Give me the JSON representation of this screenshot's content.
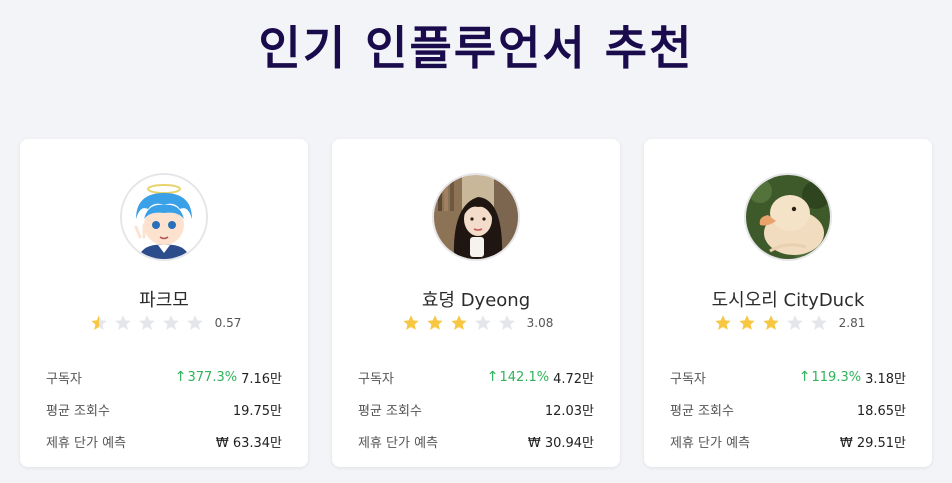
{
  "page": {
    "title": "인기 인플루언서 추천"
  },
  "colors": {
    "star_filled": "#f7c744",
    "star_empty": "#e4e6eb",
    "growth": "#2fb35a",
    "title": "#1a0b4d"
  },
  "cards": [
    {
      "name": "파크모",
      "rating": 0.57,
      "rating_text": "0.57",
      "avatar_icon": "anime-boy-avatar",
      "stats": {
        "subscribers_label": "구독자",
        "subscribers_growth": "377.3%",
        "subscribers_value": "7.16만",
        "views_label": "평균 조회수",
        "views_value": "19.75만",
        "price_label": "제휴 단가 예측",
        "price_value": "₩ 63.34만"
      }
    },
    {
      "name": "효뎡 Dyeong",
      "rating": 3.08,
      "rating_text": "3.08",
      "avatar_icon": "woman-portrait-avatar",
      "stats": {
        "subscribers_label": "구독자",
        "subscribers_growth": "142.1%",
        "subscribers_value": "4.72만",
        "views_label": "평균 조회수",
        "views_value": "12.03만",
        "price_label": "제휴 단가 예측",
        "price_value": "₩ 30.94만"
      }
    },
    {
      "name": "도시오리 CityDuck",
      "rating": 2.81,
      "rating_text": "2.81",
      "avatar_icon": "duckling-avatar",
      "stats": {
        "subscribers_label": "구독자",
        "subscribers_growth": "119.3%",
        "subscribers_value": "3.18만",
        "views_label": "평균 조회수",
        "views_value": "18.65만",
        "price_label": "제휴 단가 예측",
        "price_value": "₩ 29.51만"
      }
    }
  ]
}
